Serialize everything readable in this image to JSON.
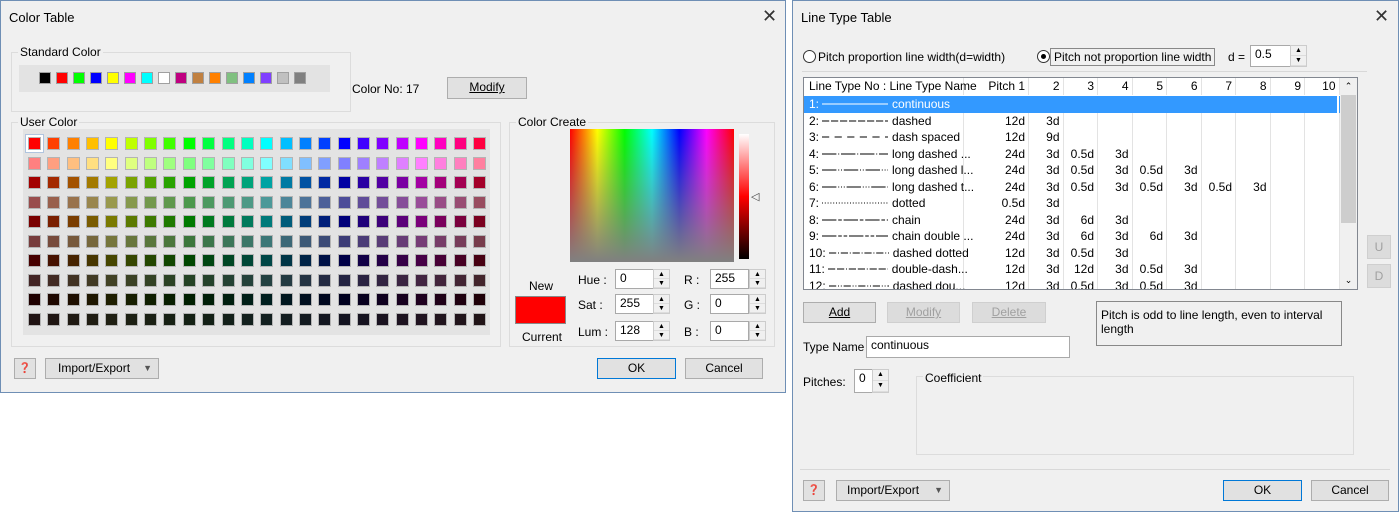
{
  "color_table": {
    "title": "Color Table",
    "standard_label": "Standard Color",
    "standard_colors": [
      "#000000",
      "#ff0000",
      "#00ff00",
      "#0000ff",
      "#ffff00",
      "#ff00ff",
      "#00ffff",
      "#ffffff",
      "#bf0080",
      "#c08040",
      "#ff8000",
      "#80c080",
      "#0080ff",
      "#8040ff",
      "#c0c0c0",
      "#808080"
    ],
    "color_no_label": "Color No:",
    "color_no": "17",
    "modify": "Modify",
    "user_label": "User Color",
    "user_hue_step": 15,
    "user_rows": [
      {
        "s": 100,
        "l": 50
      },
      {
        "s": 100,
        "l": 75
      },
      {
        "s": 100,
        "l": 32
      },
      {
        "s": 33,
        "l": 45
      },
      {
        "s": 100,
        "l": 24
      },
      {
        "s": 33,
        "l": 35
      },
      {
        "s": 100,
        "l": 14
      },
      {
        "s": 30,
        "l": 20
      },
      {
        "s": 100,
        "l": 6
      },
      {
        "s": 25,
        "l": 10
      }
    ],
    "create_label": "Color Create",
    "new_label": "New",
    "current_label": "Current",
    "current_color": "#ff0000",
    "hue_label": "Hue :",
    "hue": "0",
    "sat_label": "Sat :",
    "sat": "255",
    "lum_label": "Lum :",
    "lum": "128",
    "r_label": "R :",
    "r": "255",
    "g_label": "G :",
    "g": "0",
    "b_label": "B :",
    "b": "0",
    "import_export": "Import/Export",
    "ok": "OK",
    "cancel": "Cancel"
  },
  "line_table": {
    "title": "Line Type Table",
    "radio1": "Pitch proportion line width(d=width)",
    "radio2": "Pitch not proportion line width",
    "d_label": "d =",
    "d": "0.5",
    "headers": [
      "Line Type No : Line Type Name",
      "Pitch 1",
      "2",
      "3",
      "4",
      "5",
      "6",
      "7",
      "8",
      "9",
      "10"
    ],
    "rows": [
      {
        "no": "1:",
        "name": "continuous",
        "p": []
      },
      {
        "no": "2:",
        "name": "dashed",
        "p": [
          "12d",
          "3d"
        ]
      },
      {
        "no": "3:",
        "name": "dash spaced",
        "p": [
          "12d",
          "9d"
        ]
      },
      {
        "no": "4:",
        "name": "long dashed ...",
        "p": [
          "24d",
          "3d",
          "0.5d",
          "3d"
        ]
      },
      {
        "no": "5:",
        "name": "long dashed l...",
        "p": [
          "24d",
          "3d",
          "0.5d",
          "3d",
          "0.5d",
          "3d"
        ]
      },
      {
        "no": "6:",
        "name": "long dashed t...",
        "p": [
          "24d",
          "3d",
          "0.5d",
          "3d",
          "0.5d",
          "3d",
          "0.5d",
          "3d"
        ]
      },
      {
        "no": "7:",
        "name": "dotted",
        "p": [
          "0.5d",
          "3d"
        ]
      },
      {
        "no": "8:",
        "name": "chain",
        "p": [
          "24d",
          "3d",
          "6d",
          "3d"
        ]
      },
      {
        "no": "9:",
        "name": "chain double ...",
        "p": [
          "24d",
          "3d",
          "6d",
          "3d",
          "6d",
          "3d"
        ]
      },
      {
        "no": "10:",
        "name": "dashed dotted",
        "p": [
          "12d",
          "3d",
          "0.5d",
          "3d"
        ]
      },
      {
        "no": "11:",
        "name": "double-dash...",
        "p": [
          "12d",
          "3d",
          "12d",
          "3d",
          "0.5d",
          "3d"
        ]
      },
      {
        "no": "12:",
        "name": "dashed dou...",
        "p": [
          "12d",
          "3d",
          "0.5d",
          "3d",
          "0.5d",
          "3d"
        ]
      }
    ],
    "selected": 0,
    "up": "U",
    "down": "D",
    "add": "Add",
    "modify": "Modify",
    "delete": "Delete",
    "note": "Pitch is odd to line length, even to interval length",
    "type_name_label": "Type Name",
    "type_name": "continuous",
    "pitches_label": "Pitches:",
    "pitches": "0",
    "coefficient_label": "Coefficient",
    "import_export": "Import/Export",
    "ok": "OK",
    "cancel": "Cancel"
  }
}
